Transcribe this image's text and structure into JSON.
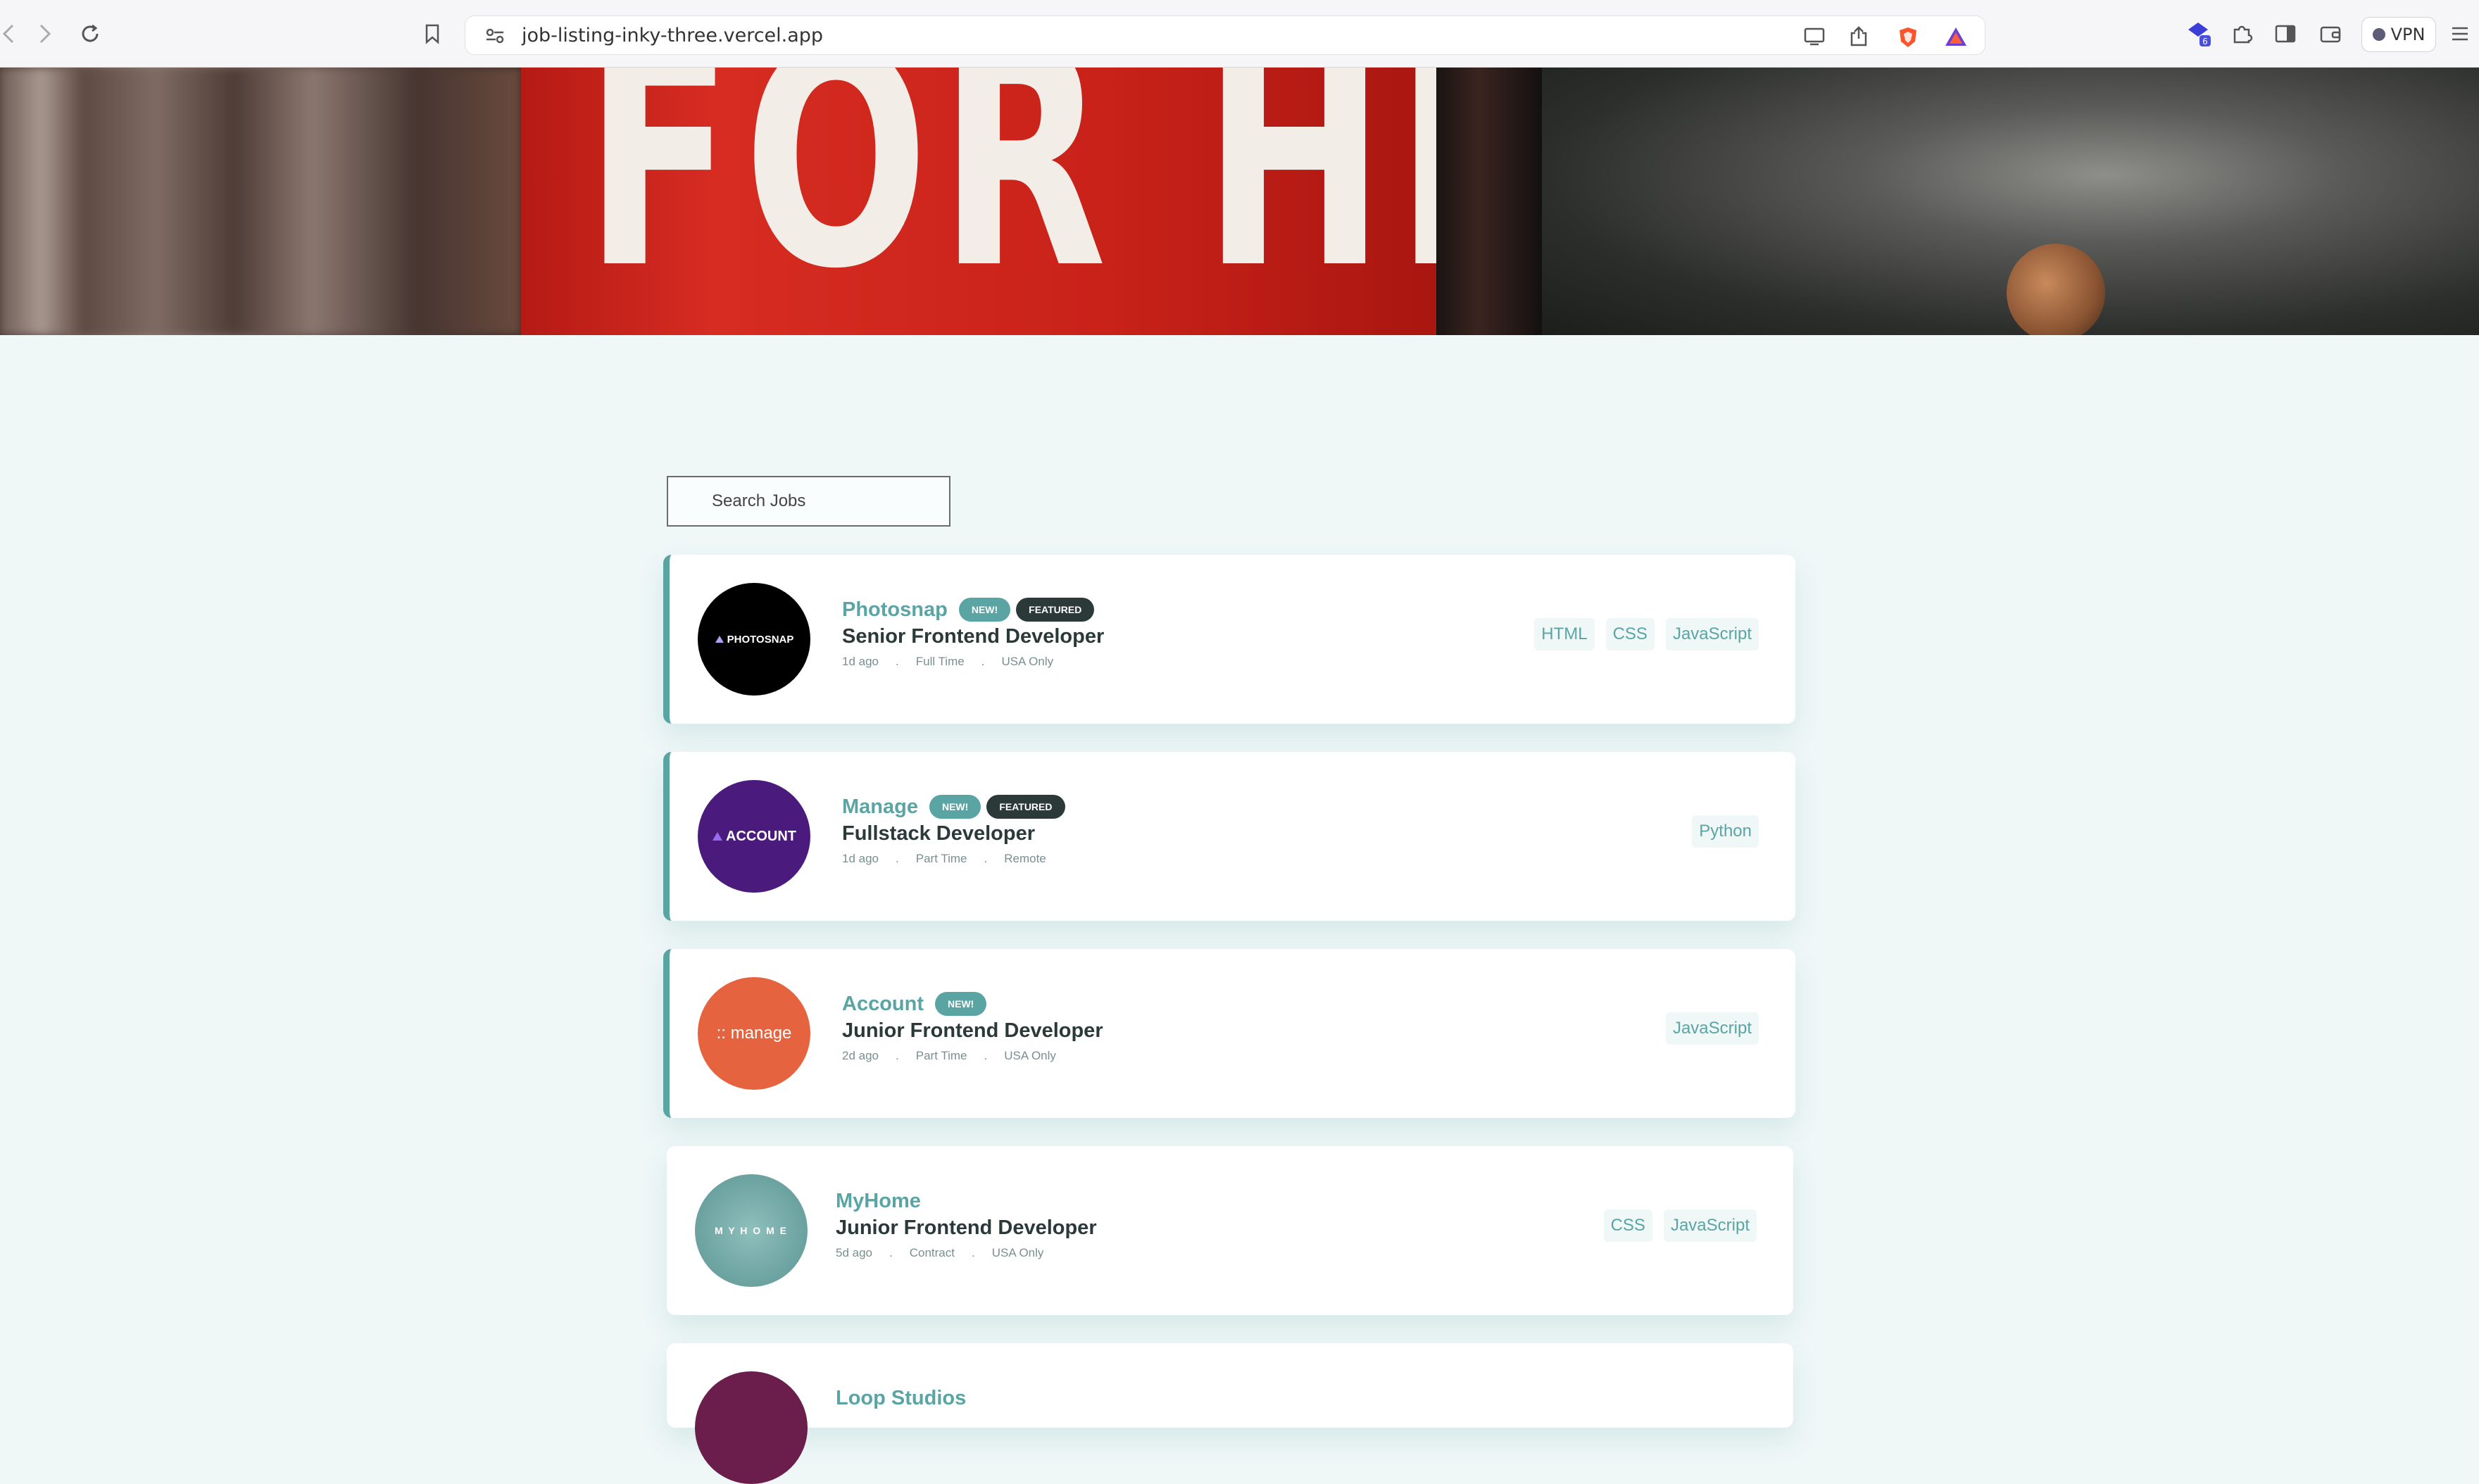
{
  "browser": {
    "url": "job-listing-inky-three.vercel.app",
    "vpn_label": "VPN",
    "ext_badge_count": "6"
  },
  "hero": {
    "sign_text": "FOR HIRE"
  },
  "search": {
    "placeholder": "Search Jobs"
  },
  "jobs": [
    {
      "company": "Photosnap",
      "logo_text": "PHOTOSNAP",
      "logo_color": "#000000",
      "new_label": "NEW!",
      "featured_label": "FEATURED",
      "position": "Senior Frontend Developer",
      "posted": "1d ago",
      "contract": "Full Time",
      "location": "USA Only",
      "sep": ".",
      "tags": [
        "HTML",
        "CSS",
        "JavaScript"
      ]
    },
    {
      "company": "Manage",
      "logo_text": "ACCOUNT",
      "logo_color": "#4a1b7c",
      "new_label": "NEW!",
      "featured_label": "FEATURED",
      "position": "Fullstack Developer",
      "posted": "1d ago",
      "contract": "Part Time",
      "location": "Remote",
      "sep": ".",
      "tags": [
        "Python"
      ]
    },
    {
      "company": "Account",
      "logo_text": ":: manage",
      "logo_color": "#e5643f",
      "new_label": "NEW!",
      "position": "Junior Frontend Developer",
      "posted": "2d ago",
      "contract": "Part Time",
      "location": "USA Only",
      "sep": ".",
      "tags": [
        "JavaScript"
      ]
    },
    {
      "company": "MyHome",
      "logo_text": "M Y H O M E",
      "logo_color": "#6fa5a3",
      "position": "Junior Frontend Developer",
      "posted": "5d ago",
      "contract": "Contract",
      "location": "USA Only",
      "sep": ".",
      "tags": [
        "CSS",
        "JavaScript"
      ]
    },
    {
      "company": "Loop Studios",
      "logo_color": "#6b1d4c"
    }
  ],
  "colors": {
    "primary": "#5ba4a4",
    "dark": "#2b3939",
    "background": "#eff7f7"
  }
}
